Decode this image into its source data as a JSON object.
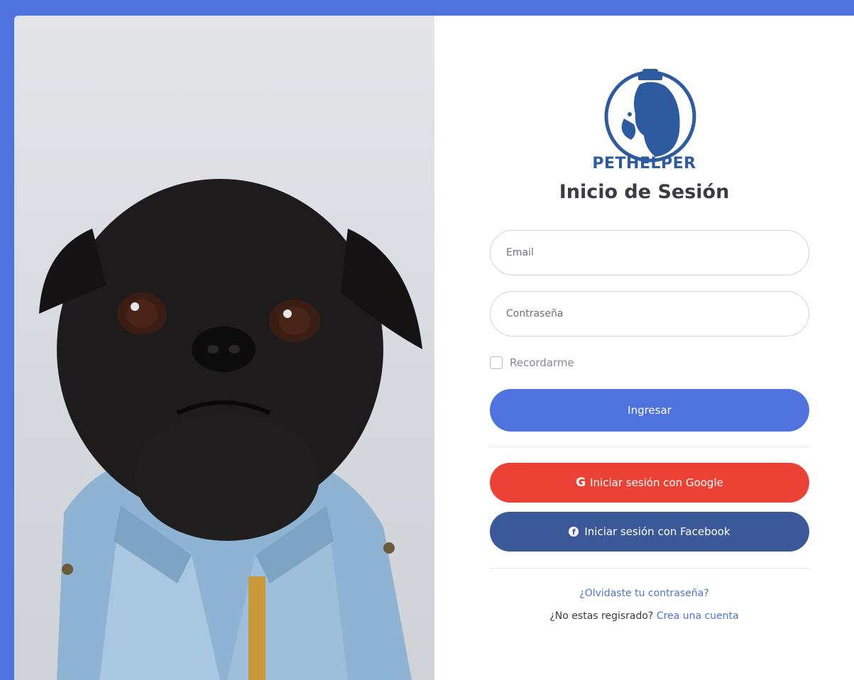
{
  "brand": {
    "name": "PETHELPER"
  },
  "form": {
    "title": "Inicio de Sesión",
    "email_placeholder": "Email",
    "password_placeholder": "Contraseña",
    "remember_label": "Recordarme",
    "login_button": "Ingresar",
    "google_button": "Iniciar sesión con Google",
    "google_icon_glyph": "G",
    "facebook_button": "Iniciar sesión con Facebook",
    "facebook_icon_glyph": "f",
    "forgot_link": "¿Olvidaste tu contraseña?",
    "register_prompt": "¿No estas regisrado?",
    "register_link": "Crea una cuenta"
  },
  "icons": {
    "logo": "pet-helper-logo",
    "google": "google-icon",
    "facebook": "facebook-icon"
  },
  "colors": {
    "primary": "#4e73df",
    "google": "#ea4335",
    "facebook": "#3b5998",
    "brand": "#2e5aa0"
  }
}
